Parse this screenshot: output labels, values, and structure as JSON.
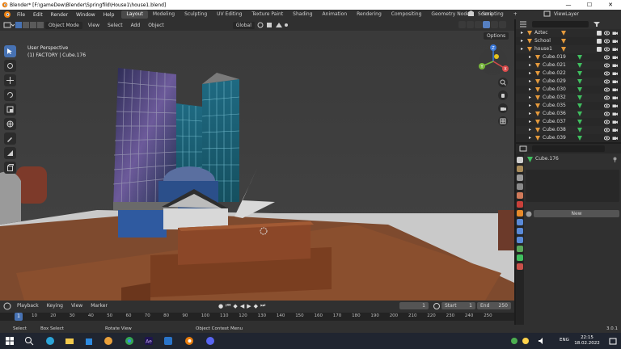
{
  "window": {
    "title": "Blender* [F:\\gameDew\\Blender\\Springfild\\House1\\house1.blend]",
    "minimize": "—",
    "maximize": "☐",
    "close": "✕"
  },
  "menu": {
    "items": [
      "File",
      "Edit",
      "Render",
      "Window",
      "Help"
    ],
    "tabs": [
      "Layout",
      "Modeling",
      "Sculpting",
      "UV Editing",
      "Texture Paint",
      "Shading",
      "Animation",
      "Rendering",
      "Compositing",
      "Geometry Nodes",
      "Scripting"
    ],
    "active_tab": "Layout",
    "add_tab": "+",
    "scene": "Scene",
    "view_layer": "ViewLayer"
  },
  "viewport_header": {
    "mode": "Object Mode",
    "menus": [
      "View",
      "Select",
      "Add",
      "Object"
    ],
    "orientation": "Global",
    "options": "Options"
  },
  "viewport": {
    "perspective": "User Perspective",
    "context": "(1) FACTORY | Cube.176",
    "gizmo_labels": [
      "Z",
      "Y",
      "X"
    ]
  },
  "outliner": {
    "rows": [
      {
        "name": "Aztec",
        "indent": 0,
        "type": "collection"
      },
      {
        "name": "School",
        "indent": 0,
        "type": "collection"
      },
      {
        "name": "house1",
        "indent": 0,
        "type": "collection"
      },
      {
        "name": "Cube.019",
        "indent": 1,
        "type": "mesh"
      },
      {
        "name": "Cube.021",
        "indent": 1,
        "type": "mesh"
      },
      {
        "name": "Cube.022",
        "indent": 1,
        "type": "mesh"
      },
      {
        "name": "Cube.029",
        "indent": 1,
        "type": "mesh"
      },
      {
        "name": "Cube.030",
        "indent": 1,
        "type": "mesh"
      },
      {
        "name": "Cube.032",
        "indent": 1,
        "type": "mesh"
      },
      {
        "name": "Cube.035",
        "indent": 1,
        "type": "mesh"
      },
      {
        "name": "Cube.036",
        "indent": 1,
        "type": "mesh"
      },
      {
        "name": "Cube.037",
        "indent": 1,
        "type": "mesh"
      },
      {
        "name": "Cube.038",
        "indent": 1,
        "type": "mesh"
      },
      {
        "name": "Cube.039",
        "indent": 1,
        "type": "mesh"
      }
    ]
  },
  "properties": {
    "object_name": "Cube.176",
    "new_label": "New"
  },
  "timeline": {
    "menus": [
      "Playback",
      "Keying",
      "View",
      "Marker"
    ],
    "current_frame": "1",
    "start_label": "Start",
    "start": "1",
    "end_label": "End",
    "end": "250",
    "ruler_current": "1",
    "ticks": [
      "10",
      "20",
      "30",
      "40",
      "50",
      "60",
      "70",
      "80",
      "90",
      "100",
      "110",
      "120",
      "130",
      "140",
      "150",
      "160",
      "170",
      "180",
      "190",
      "200",
      "210",
      "220",
      "230",
      "240",
      "250"
    ]
  },
  "status": {
    "select": "Select",
    "box_select": "Box Select",
    "rotate_view": "Rotate View",
    "context_menu": "Object Context Menu",
    "version": "3.0.1"
  },
  "taskbar": {
    "lang": "ENG",
    "time": "22:15",
    "date": "18.02.2022"
  },
  "colors": {
    "accent": "#4772b3",
    "collection_icon": "#e59a3c",
    "mesh_icon": "#3fbf5f"
  }
}
